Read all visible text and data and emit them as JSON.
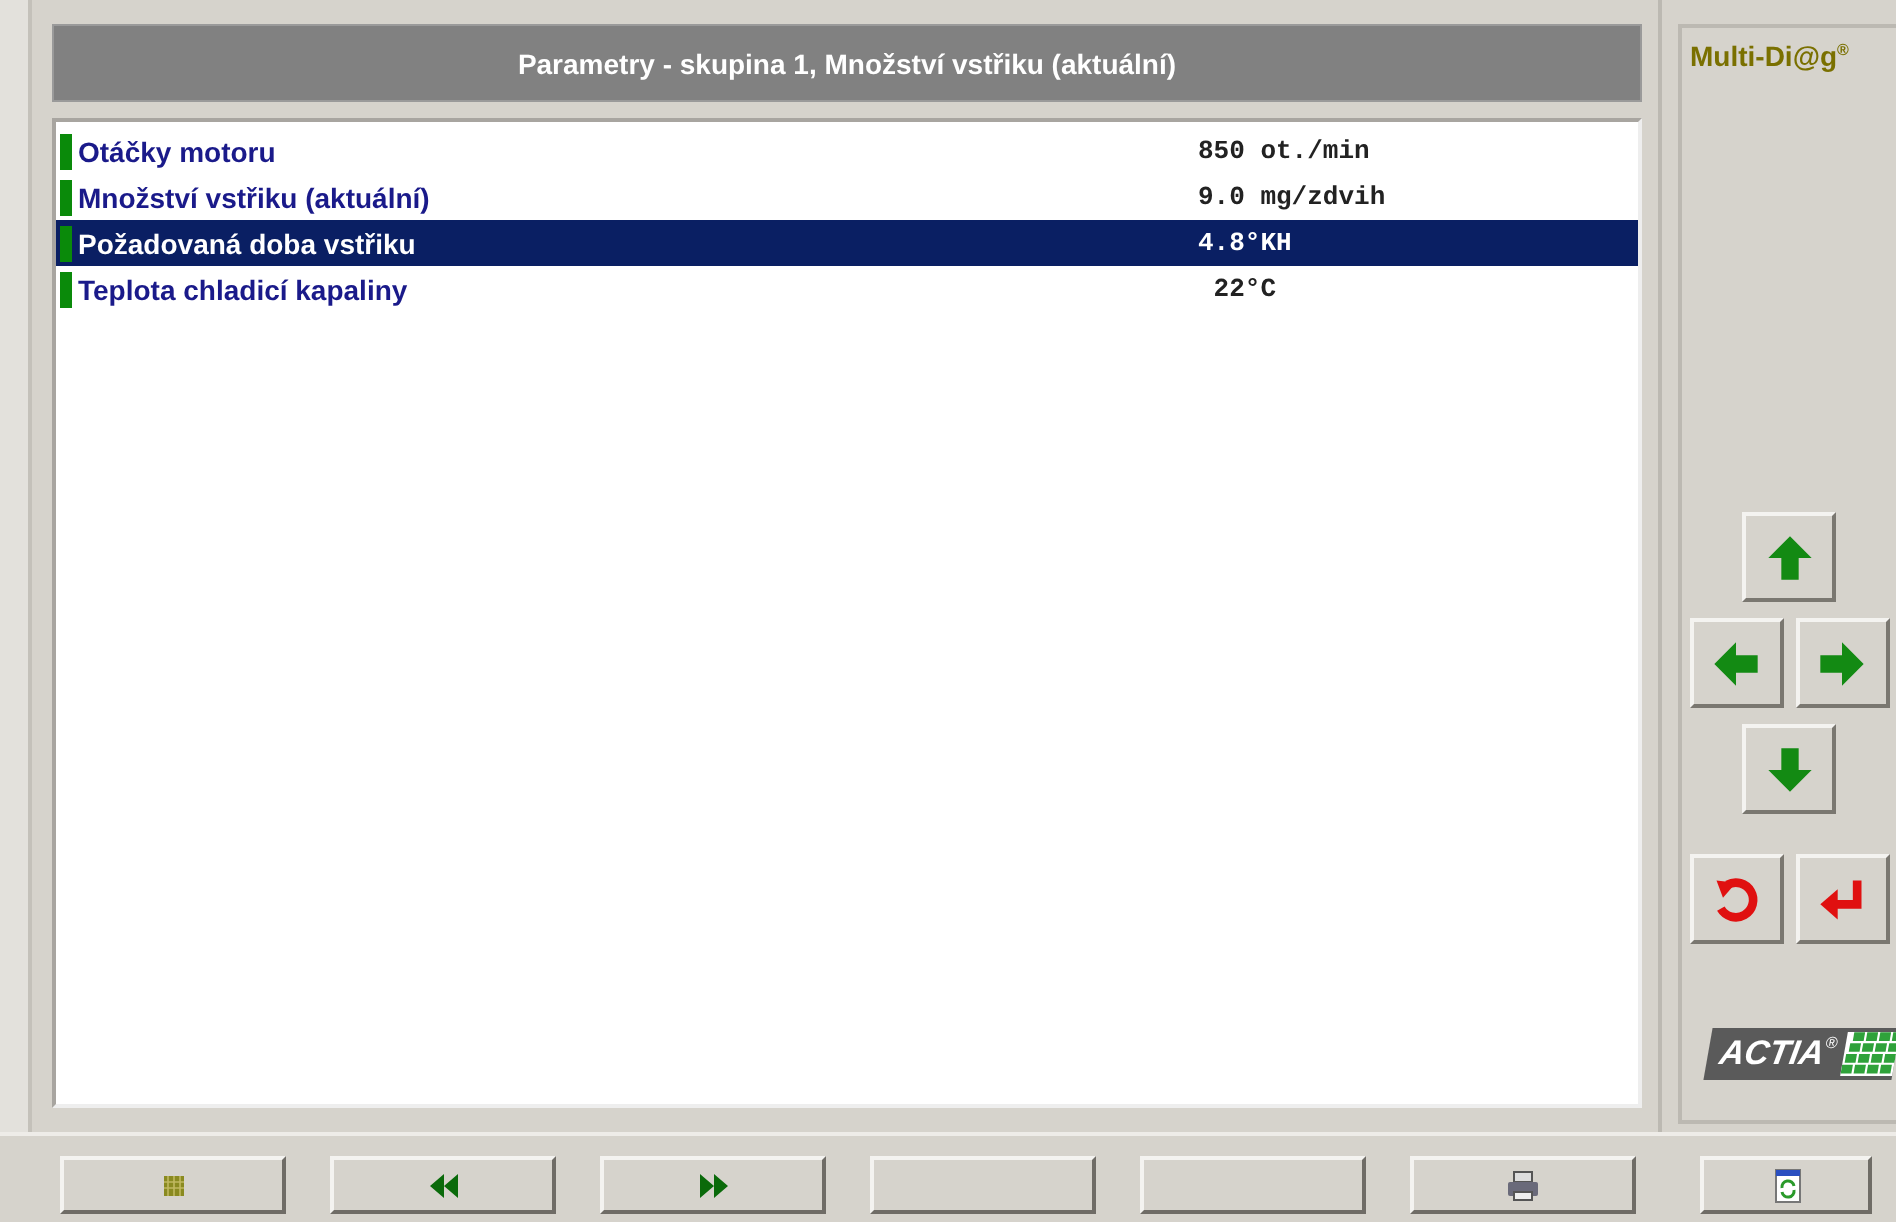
{
  "panel": {
    "title": "Parametry - skupina 1, Množství vstřiku (aktuální)"
  },
  "rows": [
    {
      "label": "Otáčky motoru",
      "value": "850 ot./min",
      "selected": false
    },
    {
      "label": "Množství vstřiku (aktuální)",
      "value": "9.0 mg/zdvih",
      "selected": false
    },
    {
      "label": "Požadovaná doba vstřiku",
      "value": "4.8°KH",
      "selected": true
    },
    {
      "label": "Teplota chladicí kapaliny",
      "value": " 22°C",
      "selected": false
    }
  ],
  "brand": {
    "product": "Multi-Di@g$^{®}$",
    "logo": "ACTIA",
    "logo_mark": "®"
  },
  "nav_buttons": [
    {
      "kind": "up"
    },
    {
      "kind": "left"
    },
    {
      "kind": "right"
    },
    {
      "kind": "down"
    },
    {
      "kind": "undo"
    },
    {
      "kind": "enter"
    }
  ],
  "toolbar": [
    {
      "kind": "stop"
    },
    {
      "kind": "rewind"
    },
    {
      "kind": "forward"
    },
    {
      "kind": "blank"
    },
    {
      "kind": "blank"
    },
    {
      "kind": "print"
    },
    {
      "kind": "calc"
    }
  ]
}
